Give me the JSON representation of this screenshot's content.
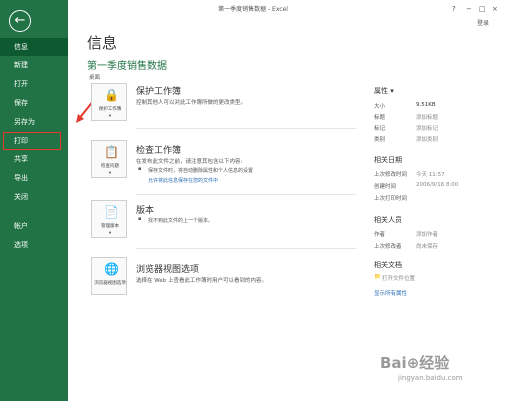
{
  "window": {
    "title": "第一季度销售数据 - Excel",
    "help": "?",
    "minimize": "−",
    "restore": "□",
    "close": "×",
    "login": "登录"
  },
  "sidebar": {
    "back": "←",
    "items": [
      {
        "label": "信息"
      },
      {
        "label": "新建"
      },
      {
        "label": "打开"
      },
      {
        "label": "保存"
      },
      {
        "label": "另存为"
      },
      {
        "label": "打印"
      },
      {
        "label": "共享"
      },
      {
        "label": "导出"
      },
      {
        "label": "关闭"
      },
      {
        "label": "帐户"
      },
      {
        "label": "选项"
      }
    ]
  },
  "main": {
    "page_title": "信息",
    "doc_title": "第一季度销售数据",
    "doc_path": "桌面",
    "sections": [
      {
        "icon_label": "保护工作簿",
        "title": "保护工作簿",
        "desc": "控制其他人可以对此工作簿所做的更改类型。"
      },
      {
        "icon_label": "检查问题",
        "title": "检查工作簿",
        "desc": "在发布此文件之前，请注意其包含以下内容:",
        "bullet": "保存文件时，将自动删除属性和个人信息的设置",
        "link": "允许将此信息保存在您的文件中"
      },
      {
        "icon_label": "管理版本",
        "title": "版本",
        "bullet": "找不到此文件的上一个版本。"
      },
      {
        "icon_label": "浏览器视图选项",
        "title": "浏览器视图选项",
        "desc": "选择在 Web 上查看此工作簿时用户可以看到的内容。"
      }
    ]
  },
  "properties": {
    "heading": "属性 ▾",
    "rows": [
      {
        "k": "大小",
        "v": "9.51KB"
      },
      {
        "k": "标题",
        "v": "添加标题"
      },
      {
        "k": "标记",
        "v": "添加标记"
      },
      {
        "k": "类别",
        "v": "添加类别"
      }
    ],
    "dates_heading": "相关日期",
    "dates": [
      {
        "k": "上次修改时间",
        "v": "今天 11:57"
      },
      {
        "k": "创建时间",
        "v": "2006/9/16 8:00"
      },
      {
        "k": "上次打印时间",
        "v": ""
      }
    ],
    "people_heading": "相关人员",
    "people": [
      {
        "k": "作者",
        "v": "添加作者"
      },
      {
        "k": "上次修改者",
        "v": "尚未保存"
      }
    ],
    "docs_heading": "相关文档",
    "open_location": "打开文件位置",
    "show_all": "显示所有属性"
  },
  "watermark": {
    "text": "Bai⊕经验",
    "sub": "jingyan.baidu.com"
  }
}
